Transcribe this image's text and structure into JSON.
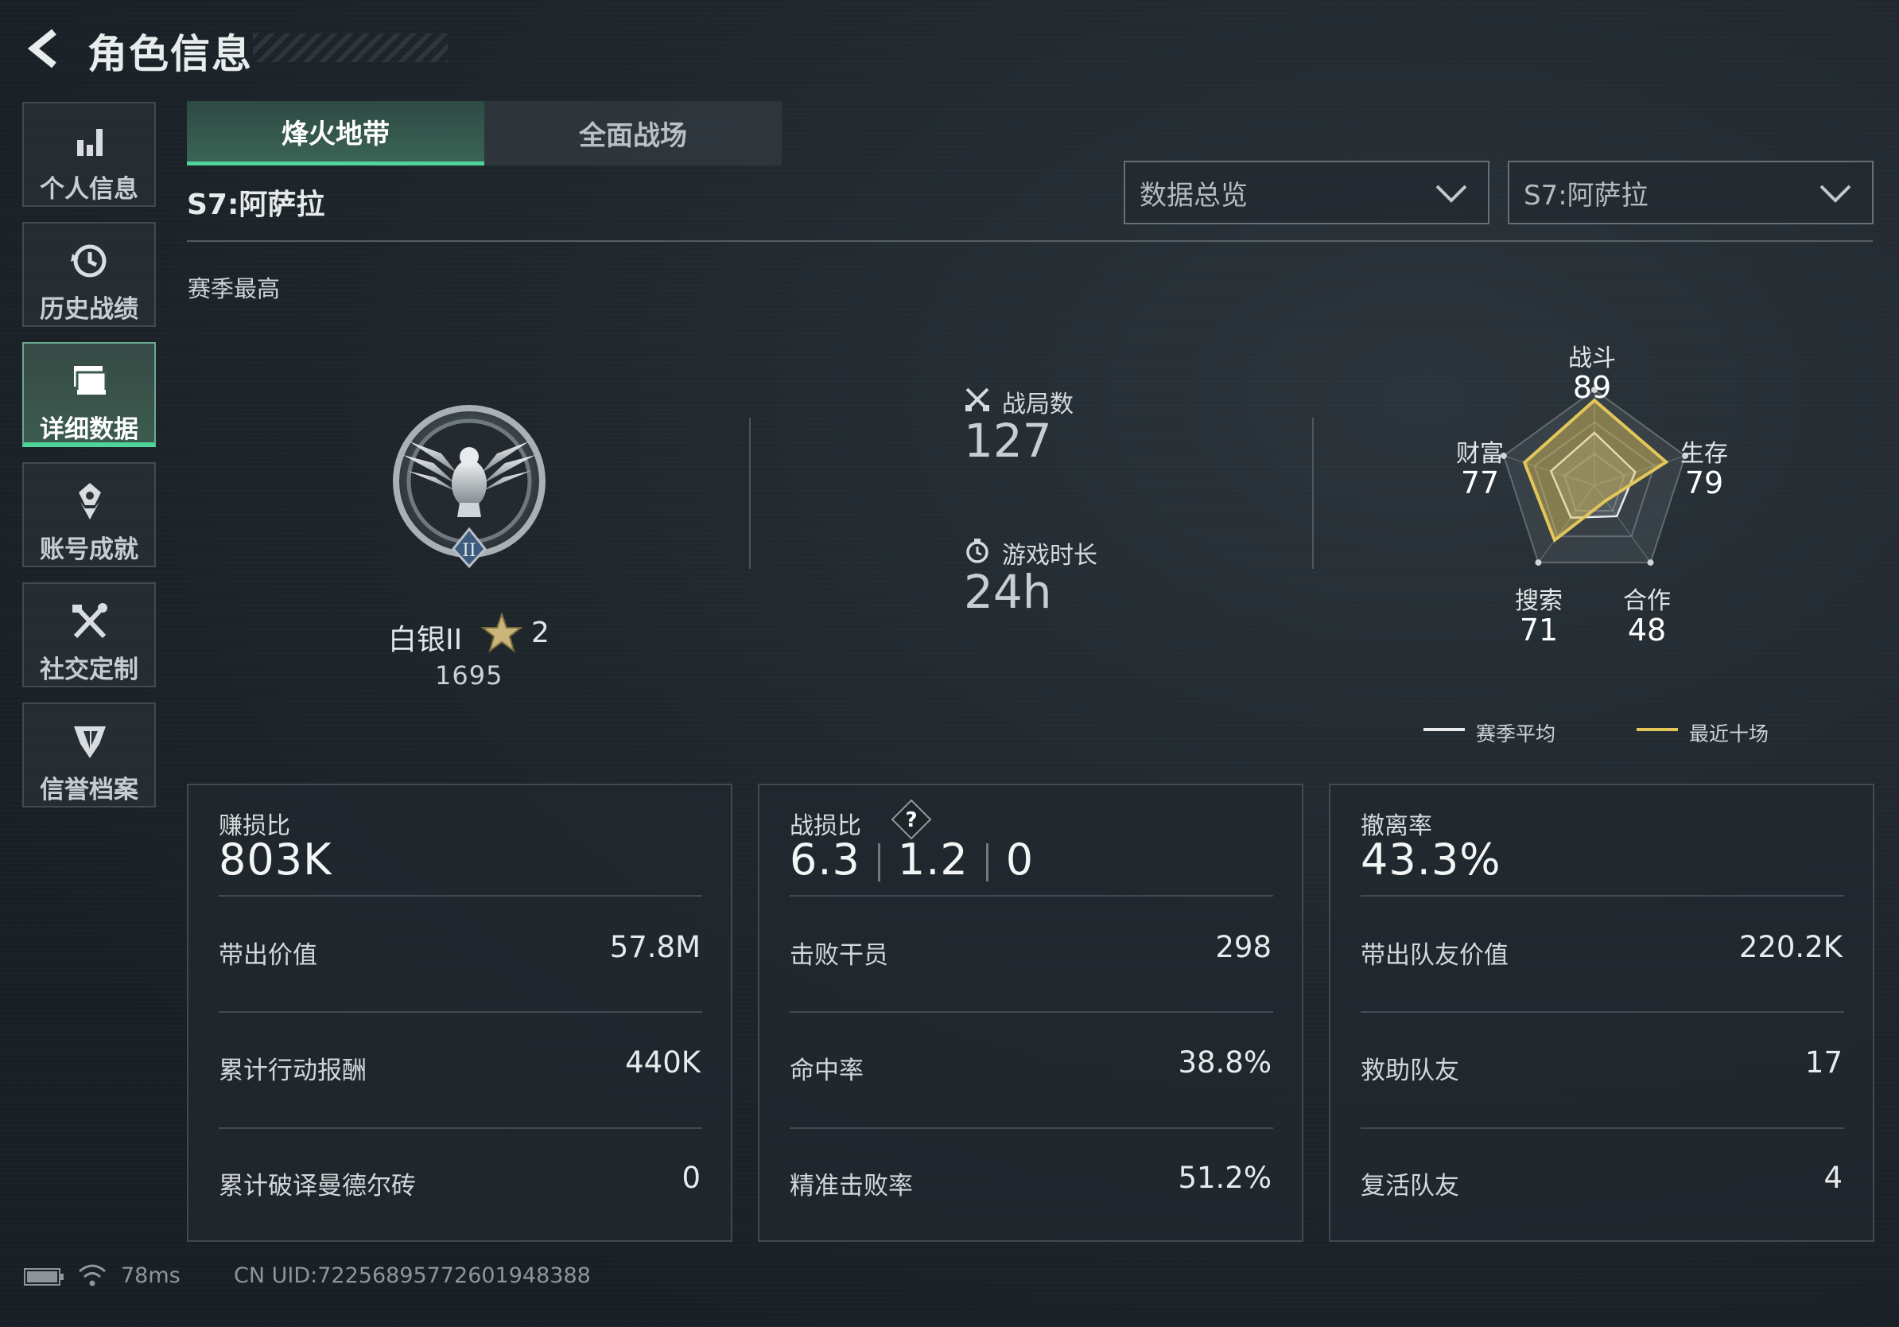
{
  "header": {
    "title": "角色信息"
  },
  "nav": {
    "items": [
      {
        "label": "个人信息",
        "icon": "bar-chart-icon",
        "active": false
      },
      {
        "label": "历史战绩",
        "icon": "history-clock-icon",
        "active": false
      },
      {
        "label": "详细数据",
        "icon": "folder-stack-icon",
        "active": true
      },
      {
        "label": "账号成就",
        "icon": "achievement-badge-icon",
        "active": false
      },
      {
        "label": "社交定制",
        "icon": "tools-icon",
        "active": false
      },
      {
        "label": "信誉档案",
        "icon": "shield-emblem-icon",
        "active": false
      }
    ]
  },
  "tabs": [
    {
      "label": "烽火地带",
      "active": true
    },
    {
      "label": "全面战场",
      "active": false
    }
  ],
  "season": {
    "label": "S7:阿萨拉"
  },
  "filters": {
    "view": {
      "value": "数据总览"
    },
    "season": {
      "value": "S7:阿萨拉"
    }
  },
  "season_best": "赛季最高",
  "rank": {
    "name": "白银II",
    "stars": "2",
    "score": "1695",
    "tier_numeral": "II"
  },
  "match_stats": {
    "games": {
      "label": "战局数",
      "value": "127",
      "icon": "crossed-swords-icon"
    },
    "playtime": {
      "label": "游戏时长",
      "value": "24h",
      "icon": "stopwatch-icon"
    }
  },
  "radar": {
    "axes": [
      {
        "name": "战斗",
        "value": "89"
      },
      {
        "name": "生存",
        "value": "79"
      },
      {
        "name": "合作",
        "value": "48"
      },
      {
        "name": "搜索",
        "value": "71"
      },
      {
        "name": "财富",
        "value": "77"
      }
    ],
    "season_avg_fraction": [
      0.55,
      0.45,
      0.4,
      0.42,
      0.48
    ],
    "recent_fraction": [
      0.89,
      0.79,
      0.2,
      0.71,
      0.77
    ],
    "legend": {
      "season_avg": "赛季平均",
      "recent": "最近十场"
    },
    "colors": {
      "season_avg": "#e8eaeb",
      "recent": "#e3c65a"
    }
  },
  "cards": [
    {
      "label": "赚损比",
      "value": "803K",
      "rows": [
        {
          "label": "带出价值",
          "value": "57.8M"
        },
        {
          "label": "累计行动报酬",
          "value": "440K"
        },
        {
          "label": "累计破译曼德尔砖",
          "value": "0"
        }
      ]
    },
    {
      "label": "战损比",
      "values": [
        "6.3",
        "1.2",
        "0"
      ],
      "rows": [
        {
          "label": "击败干员",
          "value": "298"
        },
        {
          "label": "命中率",
          "value": "38.8%"
        },
        {
          "label": "精准击败率",
          "value": "51.2%"
        }
      ]
    },
    {
      "label": "撤离率",
      "value": "43.3%",
      "rows": [
        {
          "label": "带出队友价值",
          "value": "220.2K"
        },
        {
          "label": "救助队友",
          "value": "17"
        },
        {
          "label": "复活队友",
          "value": "4"
        }
      ]
    }
  ],
  "footer": {
    "ping": "78ms",
    "uid": "CN UID:722568957726019483​88"
  },
  "colors": {
    "accent": "#4fd598",
    "background": "#1b2228"
  }
}
